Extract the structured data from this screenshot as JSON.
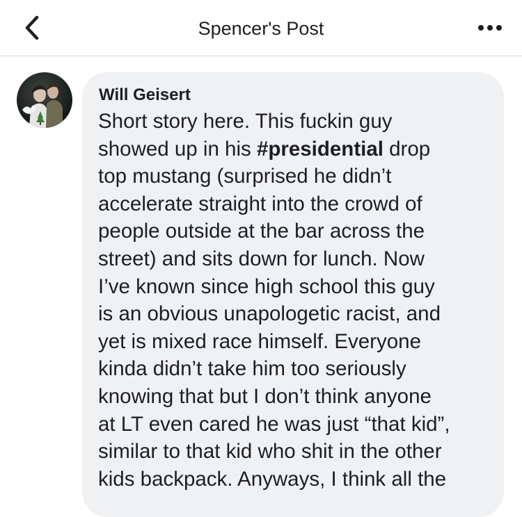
{
  "header": {
    "title": "Spencer's Post",
    "back_icon": "chevron-left-icon",
    "more_icon": "more-dots-icon"
  },
  "comment": {
    "author": "Will Geisert",
    "lines": [
      {
        "pre": "Short story here. This fuckin guy",
        "tag": "",
        "post": ""
      },
      {
        "pre": "showed up in his ",
        "tag": "#presidential",
        "post": " drop"
      },
      {
        "pre": "top mustang (surprised he didn’t",
        "tag": "",
        "post": ""
      },
      {
        "pre": "accelerate straight into the crowd of",
        "tag": "",
        "post": ""
      },
      {
        "pre": "people outside at the bar across the",
        "tag": "",
        "post": ""
      },
      {
        "pre": "street) and sits down for lunch. Now",
        "tag": "",
        "post": ""
      },
      {
        "pre": "I’ve known since high school this guy",
        "tag": "",
        "post": ""
      },
      {
        "pre": "is an obvious unapologetic racist, and",
        "tag": "",
        "post": ""
      },
      {
        "pre": "yet is mixed race himself. Everyone",
        "tag": "",
        "post": ""
      },
      {
        "pre": "kinda didn’t take him too seriously",
        "tag": "",
        "post": ""
      },
      {
        "pre": "knowing that but I don’t think anyone",
        "tag": "",
        "post": ""
      },
      {
        "pre": "at LT even cared he was just “that kid”,",
        "tag": "",
        "post": ""
      },
      {
        "pre": "similar to that kid who shit in the other",
        "tag": "",
        "post": ""
      },
      {
        "pre": "kids backpack. Anyways, I think all the",
        "tag": "",
        "post": ""
      }
    ]
  },
  "colors": {
    "bubble": "#f0f1f3",
    "text": "#1c1e21",
    "divider": "#d9dadc"
  }
}
